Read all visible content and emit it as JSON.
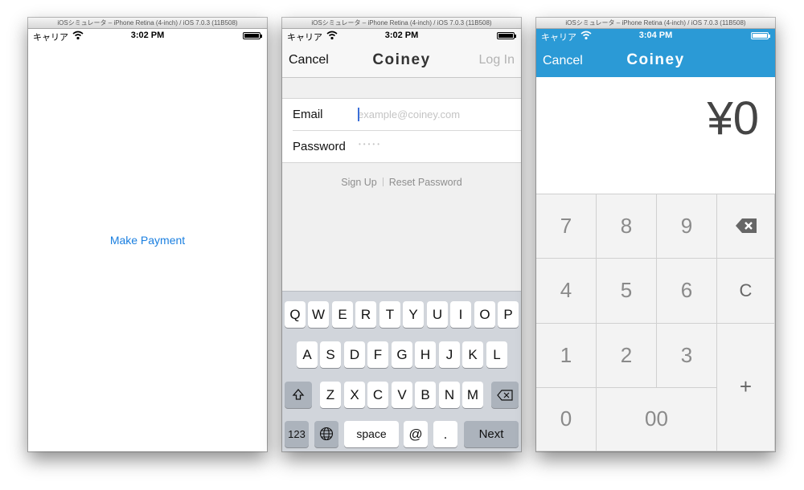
{
  "window_title": "iOSシミュレータ – iPhone Retina (4-inch) / iOS 7.0.3 (11B508)",
  "status_bar": {
    "carrier": "キャリア",
    "time1": "3:02 PM",
    "time2": "3:02 PM",
    "time3": "3:04 PM"
  },
  "screen1": {
    "make_payment": "Make Payment",
    "link_color": "#1a7fe0"
  },
  "screen2": {
    "nav": {
      "cancel": "Cancel",
      "title": "Coiney",
      "login": "Log In"
    },
    "form": {
      "email_label": "Email",
      "email_placeholder": "example@coiney.com",
      "email_value": "",
      "password_label": "Password",
      "password_dots": "•••••"
    },
    "links": {
      "signup": "Sign Up",
      "reset": "Reset Password"
    },
    "keyboard": {
      "row1": [
        "Q",
        "W",
        "E",
        "R",
        "T",
        "Y",
        "U",
        "I",
        "O",
        "P"
      ],
      "row2": [
        "A",
        "S",
        "D",
        "F",
        "G",
        "H",
        "J",
        "K",
        "L"
      ],
      "row3": [
        "Z",
        "X",
        "C",
        "V",
        "B",
        "N",
        "M"
      ],
      "shift_icon": "shift-icon",
      "delete_icon": "backspace-icon",
      "numbers": "123",
      "globe_icon": "globe-icon",
      "space": "space",
      "at": "@",
      "period": ".",
      "next": "Next"
    }
  },
  "screen3": {
    "header": {
      "cancel": "Cancel",
      "title": "Coiney",
      "color": "#2b9ad6"
    },
    "amount": "¥0",
    "keypad": {
      "k7": "7",
      "k8": "8",
      "k9": "9",
      "backspace_icon": "backspace-icon",
      "k4": "4",
      "k5": "5",
      "k6": "6",
      "clear": "C",
      "k1": "1",
      "k2": "2",
      "k3": "3",
      "plus": "+",
      "k0": "0",
      "k00": "00"
    }
  }
}
